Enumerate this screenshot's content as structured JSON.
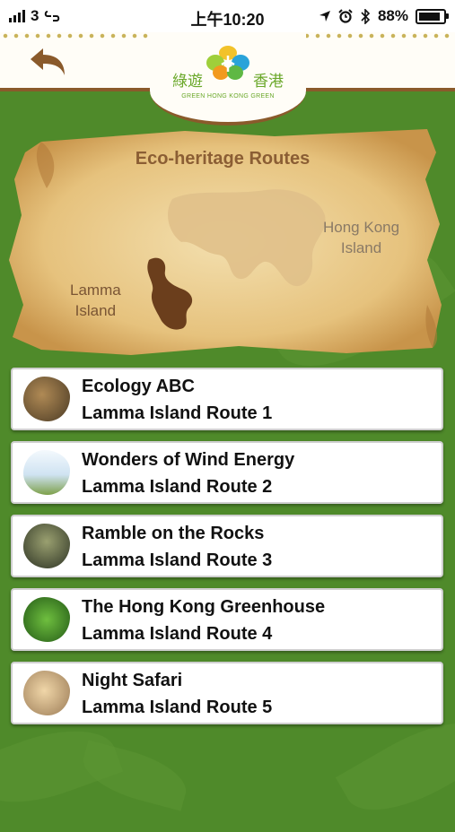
{
  "status": {
    "carrier": "3",
    "time": "上午10:20",
    "battery": "88%",
    "battery_level": 0.88
  },
  "header": {
    "logo_cn_left": "綠遊",
    "logo_cn_right": "香港",
    "logo_en": "GREEN HONG KONG GREEN"
  },
  "map": {
    "title": "Eco-heritage Routes",
    "lamma_label_1": "Lamma",
    "lamma_label_2": "Island",
    "hk_label_1": "Hong Kong",
    "hk_label_2": "Island"
  },
  "routes": [
    {
      "title": "Ecology ABC",
      "subtitle": "Lamma Island Route 1",
      "thumb_color": "#7a5a36"
    },
    {
      "title": "Wonders of Wind Energy",
      "subtitle": "Lamma Island Route 2",
      "thumb_color": "#cfe3f2"
    },
    {
      "title": "Ramble on the Rocks",
      "subtitle": "Lamma Island Route 3",
      "thumb_color": "#4a5a3a"
    },
    {
      "title": "The Hong Kong Greenhouse",
      "subtitle": "Lamma Island Route 4",
      "thumb_color": "#3f8a2a"
    },
    {
      "title": "Night Safari",
      "subtitle": "Lamma Island Route 5",
      "thumb_color": "#d8b98a"
    }
  ]
}
